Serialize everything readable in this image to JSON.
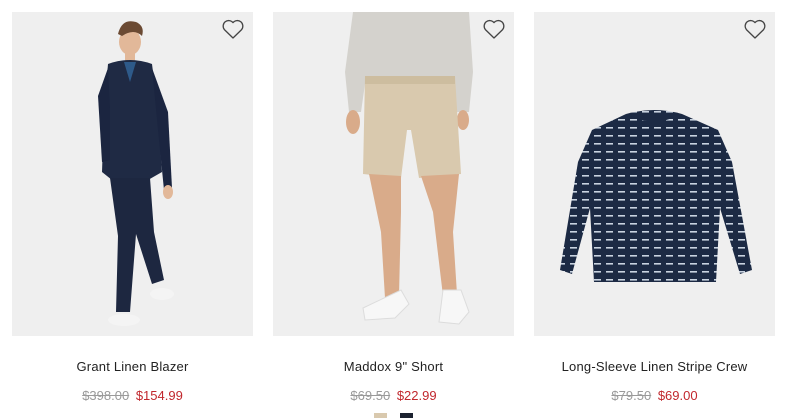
{
  "products": [
    {
      "name": "Grant Linen Blazer",
      "original_price": "$398.00",
      "sale_price": "$154.99",
      "image": "man-in-navy-linen-suit",
      "wishlist_icon": "heart-outline-icon"
    },
    {
      "name": "Maddox 9\" Short",
      "original_price": "$69.50",
      "sale_price": "$22.99",
      "image": "khaki-shorts-with-grey-sweater",
      "wishlist_icon": "heart-outline-icon",
      "swatches": [
        "#d9c9ae",
        "#1c2230"
      ]
    },
    {
      "name": "Long-Sleeve Linen Stripe Crew",
      "original_price": "$79.50",
      "sale_price": "$69.00",
      "image": "navy-striped-long-sleeve-crew",
      "wishlist_icon": "heart-outline-icon"
    }
  ],
  "colors": {
    "sale_price": "#c1272d",
    "original_price": "#9a9a9a",
    "image_background": "#efefef"
  }
}
